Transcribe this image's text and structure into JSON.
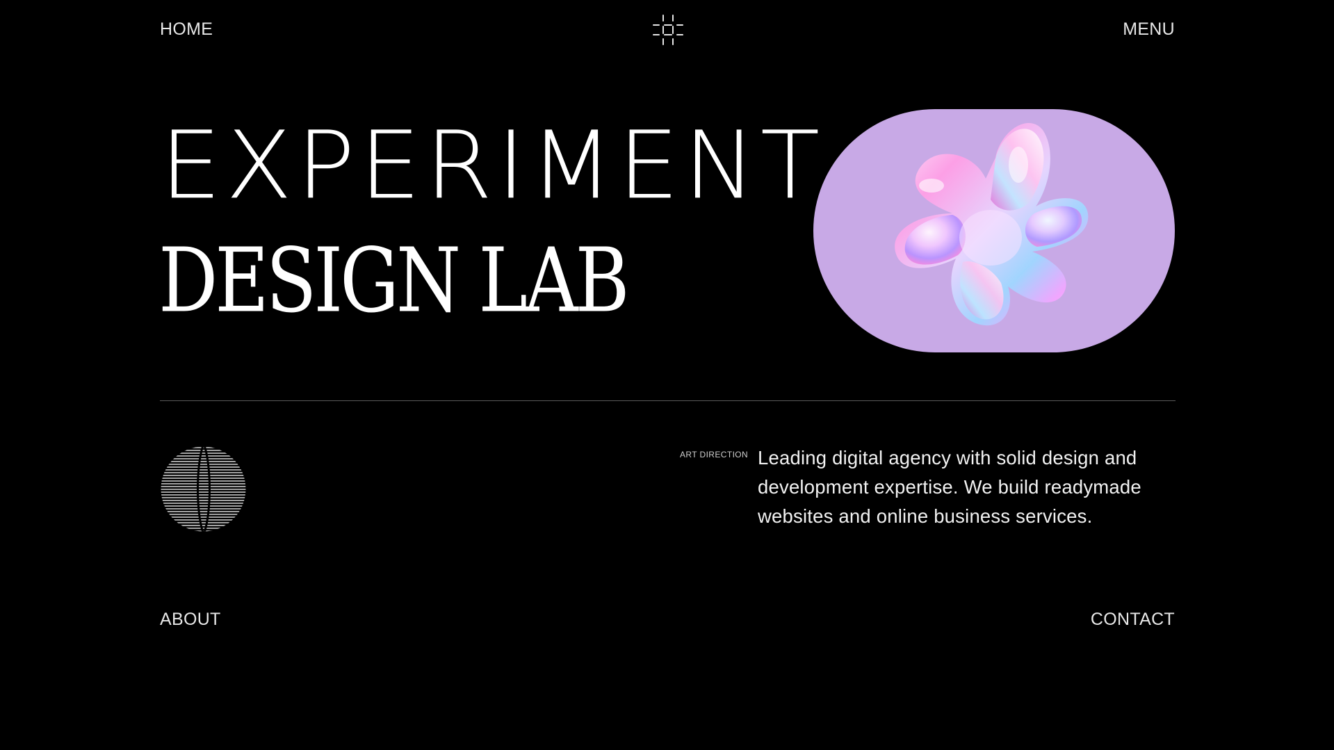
{
  "nav": {
    "home": "HOME",
    "menu": "MENU",
    "about": "ABOUT",
    "contact": "CONTACT"
  },
  "logo": {
    "icon": "grid-sparkle-icon"
  },
  "hero": {
    "line1": "EXPERIMENT",
    "line2": "DESIGN LAB"
  },
  "media": {
    "icon": "iridescent-blob",
    "background_color": "#c8a9e6"
  },
  "section": {
    "tag": "ART DIRECTION",
    "description": "Leading digital agency with solid design and development expertise. We build readymade websites and online business services."
  },
  "decor": {
    "icon": "striped-sphere-icon"
  }
}
